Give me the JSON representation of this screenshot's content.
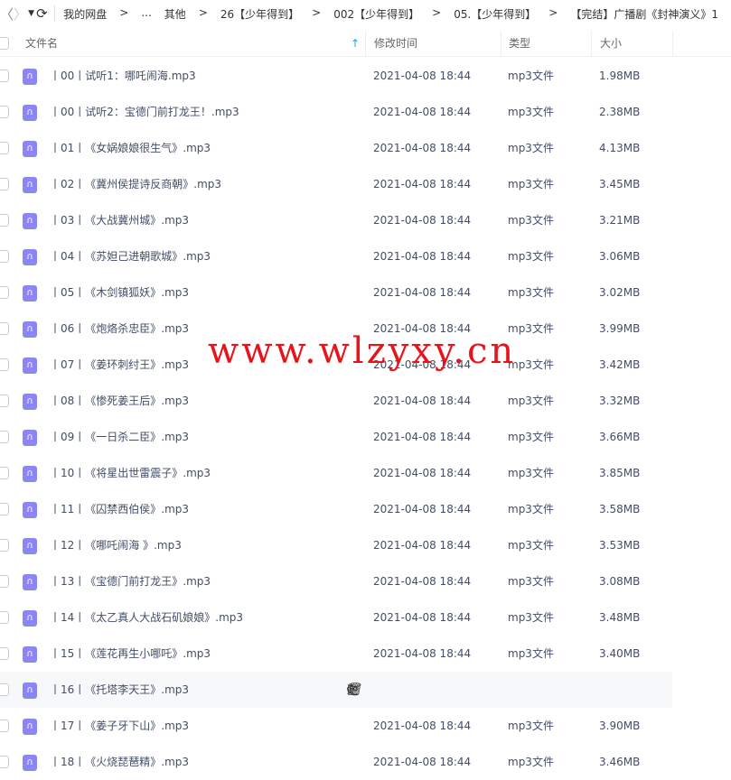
{
  "nav": {
    "breadcrumbs": [
      "我的网盘",
      "...",
      "其他",
      "26【少年得到】",
      "002【少年得到】",
      "05.【少年得到】",
      "【完结】广播剧《封神演义》1"
    ]
  },
  "header": {
    "name": "文件名",
    "modified": "修改时间",
    "type": "类型",
    "size": "大小"
  },
  "files": [
    {
      "name": "丨00丨试听1：哪吒闹海.mp3",
      "modified": "2021-04-08 18:44",
      "type": "mp3文件",
      "size": "1.98MB"
    },
    {
      "name": "丨00丨试听2：宝德门前打龙王！.mp3",
      "modified": "2021-04-08 18:44",
      "type": "mp3文件",
      "size": "2.38MB"
    },
    {
      "name": "丨01丨《女娲娘娘很生气》.mp3",
      "modified": "2021-04-08 18:44",
      "type": "mp3文件",
      "size": "4.13MB"
    },
    {
      "name": "丨02丨《冀州侯提诗反商朝》.mp3",
      "modified": "2021-04-08 18:44",
      "type": "mp3文件",
      "size": "3.45MB"
    },
    {
      "name": "丨03丨《大战冀州城》.mp3",
      "modified": "2021-04-08 18:44",
      "type": "mp3文件",
      "size": "3.21MB"
    },
    {
      "name": "丨04丨《苏妲己进朝歌城》.mp3",
      "modified": "2021-04-08 18:44",
      "type": "mp3文件",
      "size": "3.06MB"
    },
    {
      "name": "丨05丨《木剑镇狐妖》.mp3",
      "modified": "2021-04-08 18:44",
      "type": "mp3文件",
      "size": "3.02MB"
    },
    {
      "name": "丨06丨《炮烙杀忠臣》.mp3",
      "modified": "2021-04-08 18:44",
      "type": "mp3文件",
      "size": "3.99MB"
    },
    {
      "name": "丨07丨《姜环刺纣王》.mp3",
      "modified": "2021-04-08 18:44",
      "type": "mp3文件",
      "size": "3.42MB"
    },
    {
      "name": "丨08丨《惨死姜王后》.mp3",
      "modified": "2021-04-08 18:44",
      "type": "mp3文件",
      "size": "3.32MB"
    },
    {
      "name": "丨09丨《一日杀二臣》.mp3",
      "modified": "2021-04-08 18:44",
      "type": "mp3文件",
      "size": "3.66MB"
    },
    {
      "name": "丨10丨《将星出世雷震子》.mp3",
      "modified": "2021-04-08 18:44",
      "type": "mp3文件",
      "size": "3.85MB"
    },
    {
      "name": "丨11丨《囚禁西伯侯》.mp3",
      "modified": "2021-04-08 18:44",
      "type": "mp3文件",
      "size": "3.58MB"
    },
    {
      "name": "丨12丨《哪吒闹海 》.mp3",
      "modified": "2021-04-08 18:44",
      "type": "mp3文件",
      "size": "3.53MB"
    },
    {
      "name": "丨13丨《宝德门前打龙王》.mp3",
      "modified": "2021-04-08 18:44",
      "type": "mp3文件",
      "size": "3.08MB"
    },
    {
      "name": "丨14丨《太乙真人大战石矶娘娘》.mp3",
      "modified": "2021-04-08 18:44",
      "type": "mp3文件",
      "size": "3.48MB"
    },
    {
      "name": "丨15丨《莲花再生小哪吒》.mp3",
      "modified": "2021-04-08 18:44",
      "type": "mp3文件",
      "size": "3.40MB"
    },
    {
      "name": "丨16丨《托塔李天王》.mp3",
      "modified": "",
      "type": "",
      "size": "",
      "hover": true
    },
    {
      "name": "丨17丨《姜子牙下山》.mp3",
      "modified": "2021-04-08 18:44",
      "type": "mp3文件",
      "size": "3.90MB"
    },
    {
      "name": "丨18丨《火烧琵琶精》.mp3",
      "modified": "2021-04-08 18:44",
      "type": "mp3文件",
      "size": "3.46MB"
    }
  ],
  "watermark": "www.wlzyxy.cn",
  "colors": {
    "file_icon": "#8b86f6",
    "sort_arrow": "#06a7ff",
    "watermark": "#e8141b"
  }
}
